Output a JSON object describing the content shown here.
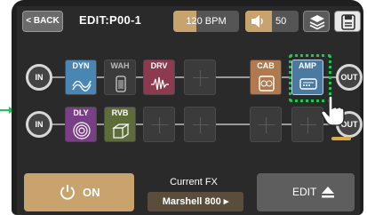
{
  "topbar": {
    "back_label": "< BACK",
    "title": "EDIT:P00-1",
    "bpm_label": "120 BPM",
    "bpm_fill_fraction": 0.35,
    "volume_label": "50",
    "volume_fill_fraction": 0.5
  },
  "chain1": {
    "in_label": "IN",
    "out_label": "OUT",
    "slots": [
      {
        "label": "DYN",
        "color": "#4a86b4",
        "icon": "dyn-wave-icon"
      },
      {
        "label": "WAH",
        "color": "#3b3b3b",
        "icon": "wah-pedal-icon"
      },
      {
        "label": "DRV",
        "color": "#8c3a4e",
        "icon": "drive-wave-icon"
      },
      {
        "label": "",
        "color": "#3b3b3b",
        "icon": "empty-slot-icon"
      },
      {
        "label": "CAB",
        "color": "#b07a4e",
        "icon": "cab-speaker-icon"
      },
      {
        "label": "AMP",
        "color": "#4a7aa0",
        "icon": "amp-head-icon"
      }
    ]
  },
  "chain2": {
    "in_label": "IN",
    "out_label": "OUT",
    "slots": [
      {
        "label": "DLY",
        "color": "#7a3e86",
        "icon": "delay-circles-icon"
      },
      {
        "label": "RVB",
        "color": "#5c6d3a",
        "icon": "reverb-cube-icon"
      },
      {
        "label": "",
        "color": "#3b3b3b",
        "icon": "empty-slot-icon"
      },
      {
        "label": "",
        "color": "#3b3b3b",
        "icon": "empty-slot-icon"
      },
      {
        "label": "",
        "color": "#3b3b3b",
        "icon": "empty-slot-icon"
      },
      {
        "label": "",
        "color": "#3b3b3b",
        "icon": "empty-slot-icon"
      }
    ]
  },
  "bottom": {
    "on_label": "ON",
    "current_fx_label": "Current FX",
    "current_fx_value": "Marshell 800 ▸",
    "edit_label": "EDIT"
  },
  "colors": {
    "accent": "#c9a36e",
    "highlight": "#22c25a"
  }
}
